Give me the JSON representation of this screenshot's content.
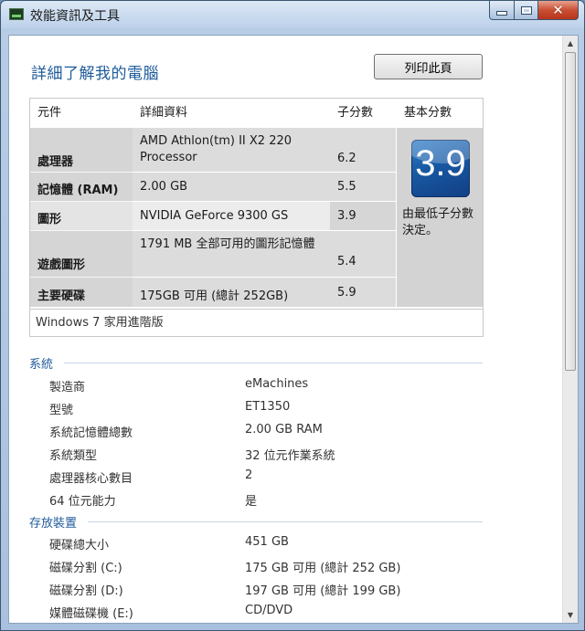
{
  "window": {
    "title": "效能資訊及工具"
  },
  "header": {
    "page_title": "詳細了解我的電腦",
    "print_button": "列印此頁"
  },
  "score_table": {
    "columns": [
      "元件",
      "詳細資料",
      "子分數",
      "基本分數"
    ],
    "rows": [
      {
        "component": "處理器",
        "detail": "AMD Athlon(tm) II X2 220 Processor",
        "subscore": "6.2"
      },
      {
        "component": "記憶體 (RAM)",
        "detail": "2.00 GB",
        "subscore": "5.5"
      },
      {
        "component": "圖形",
        "detail": "NVIDIA GeForce 9300 GS",
        "subscore": "3.9"
      },
      {
        "component": "遊戲圖形",
        "detail": "1791 MB 全部可用的圖形記憶體",
        "subscore": "5.4"
      },
      {
        "component": "主要硬碟",
        "detail": "175GB 可用 (總計 252GB)",
        "subscore": "5.9"
      }
    ],
    "base_score": "3.9",
    "base_note": "由最低子分數決定。",
    "edition": "Windows 7 家用進階版"
  },
  "system": {
    "heading": "系統",
    "items": [
      {
        "key": "製造商",
        "value": "eMachines"
      },
      {
        "key": "型號",
        "value": "ET1350"
      },
      {
        "key": "系統記憶體總數",
        "value": "2.00 GB RAM"
      },
      {
        "key": "系統類型",
        "value": "32 位元作業系統"
      },
      {
        "key": "處理器核心數目",
        "value": "2"
      },
      {
        "key": "64 位元能力",
        "value": "是"
      }
    ]
  },
  "storage": {
    "heading": "存放裝置",
    "items": [
      {
        "key": "硬碟總大小",
        "value": "451 GB"
      },
      {
        "key": "磁碟分割 (C:)",
        "value": "175 GB 可用 (總計 252 GB)"
      },
      {
        "key": "磁碟分割 (D:)",
        "value": "197 GB 可用 (總計 199 GB)"
      },
      {
        "key": "媒體磁碟機 (E:)",
        "value": "CD/DVD"
      }
    ]
  }
}
